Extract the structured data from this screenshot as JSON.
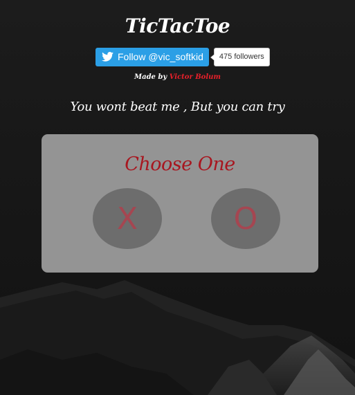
{
  "header": {
    "title": "TicTacToe"
  },
  "twitter": {
    "follow_label": "Follow @vic_softkid",
    "icon": "twitter-bird-icon",
    "followers_label": "475 followers",
    "brand_color": "#2b9fe6"
  },
  "credit": {
    "prefix": "Made by ",
    "author": "Victor Bolum",
    "author_color": "#e8202a"
  },
  "tagline": "You wont beat me , But you can try",
  "choose_panel": {
    "title": "Choose One",
    "title_color": "#a8161f",
    "options": [
      {
        "label": "X"
      },
      {
        "label": "O"
      }
    ]
  }
}
